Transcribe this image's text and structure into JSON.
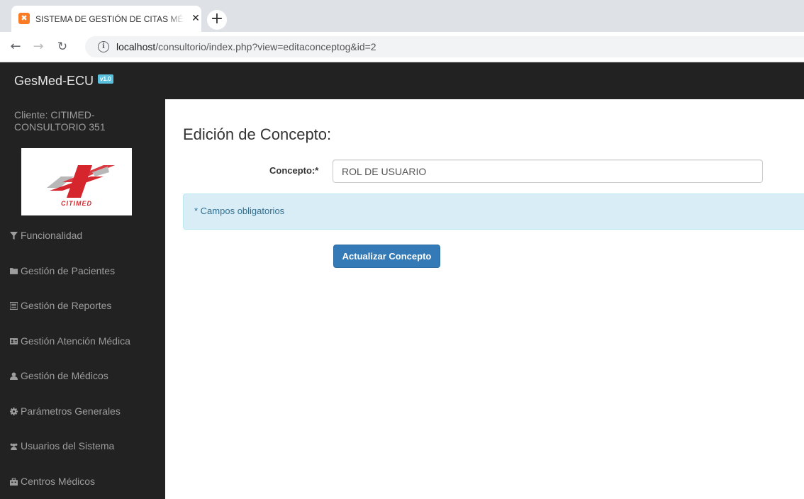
{
  "browser": {
    "tab_title": "SISTEMA DE GESTIÓN DE CITAS MÉDICAS",
    "tab_close": "✕",
    "new_tab": "+",
    "url_host": "localhost",
    "url_path": "/consultorio/index.php?view=editaconceptog&id=2"
  },
  "header": {
    "brand": "GesMed-ECU",
    "version_badge": "v1.0"
  },
  "sidebar": {
    "client": "Cliente: CITIMED- CONSULTORIO 351",
    "logo_text": "CITIMED",
    "items": [
      {
        "label": "Funcionalidad",
        "icon": "filter-icon"
      },
      {
        "label": "Gestión de Pacientes",
        "icon": "folder-icon"
      },
      {
        "label": "Gestión de Reportes",
        "icon": "list-alt-icon"
      },
      {
        "label": "Gestión Atención Médica",
        "icon": "id-card-icon"
      },
      {
        "label": "Gestión de Médicos",
        "icon": "user-icon"
      },
      {
        "label": "Parámetros Generales",
        "icon": "cog-icon"
      },
      {
        "label": "Usuarios del Sistema",
        "icon": "users-icon"
      },
      {
        "label": "Centros Médicos",
        "icon": "building-icon"
      }
    ]
  },
  "main": {
    "title": "Edición de Concepto:",
    "field_label": "Concepto:*",
    "field_value": "ROL DE USUARIO",
    "alert": "* Campos obligatorios",
    "submit": "Actualizar Concepto"
  },
  "colors": {
    "navbar": "#222222",
    "primary": "#337ab7",
    "alert_bg": "#d9edf7",
    "alert_text": "#31708f",
    "logo_red": "#d6262d"
  }
}
